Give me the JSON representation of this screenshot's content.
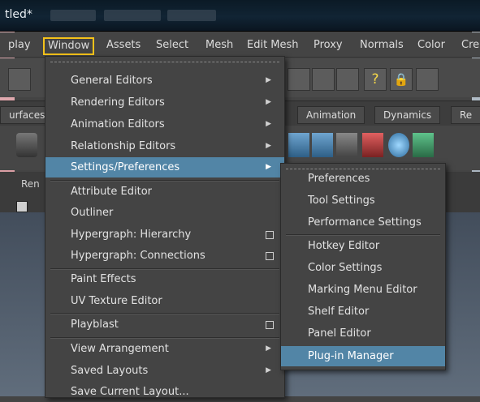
{
  "titlebar": {
    "title": "tled*"
  },
  "menubar": {
    "items": [
      "play",
      "Window",
      "Assets",
      "Select",
      "Mesh",
      "Edit Mesh",
      "Proxy",
      "Normals",
      "Color",
      "Cre"
    ],
    "active_index": 1
  },
  "shelf_tabs": [
    "urfaces",
    "Animation",
    "Dynamics",
    "Re"
  ],
  "viewport_label": "Ren",
  "window_menu": {
    "items": [
      {
        "label": "General Editors",
        "submenu": true
      },
      {
        "label": "Rendering Editors",
        "submenu": true
      },
      {
        "label": "Animation Editors",
        "submenu": true
      },
      {
        "label": "Relationship Editors",
        "submenu": true
      },
      {
        "label": "Settings/Preferences",
        "submenu": true,
        "highlighted": true
      },
      {
        "label": "Attribute Editor"
      },
      {
        "label": "Outliner"
      },
      {
        "label": "Hypergraph: Hierarchy",
        "option_box": true
      },
      {
        "label": "Hypergraph: Connections",
        "option_box": true
      },
      {
        "label": "Paint Effects"
      },
      {
        "label": "UV Texture Editor"
      },
      {
        "label": "Playblast",
        "option_box": true
      },
      {
        "label": "View Arrangement",
        "submenu": true
      },
      {
        "label": "Saved Layouts",
        "submenu": true
      },
      {
        "label": "Save Current Layout..."
      }
    ]
  },
  "settings_submenu": {
    "items": [
      {
        "label": "Preferences"
      },
      {
        "label": "Tool Settings"
      },
      {
        "label": "Performance Settings"
      },
      {
        "label": "Hotkey Editor"
      },
      {
        "label": "Color Settings"
      },
      {
        "label": "Marking Menu Editor"
      },
      {
        "label": "Shelf Editor"
      },
      {
        "label": "Panel Editor"
      },
      {
        "label": "Plug-in Manager",
        "highlighted": true
      }
    ]
  },
  "colors": {
    "highlight": "#5285a6",
    "active_outline": "#f5c21a"
  }
}
